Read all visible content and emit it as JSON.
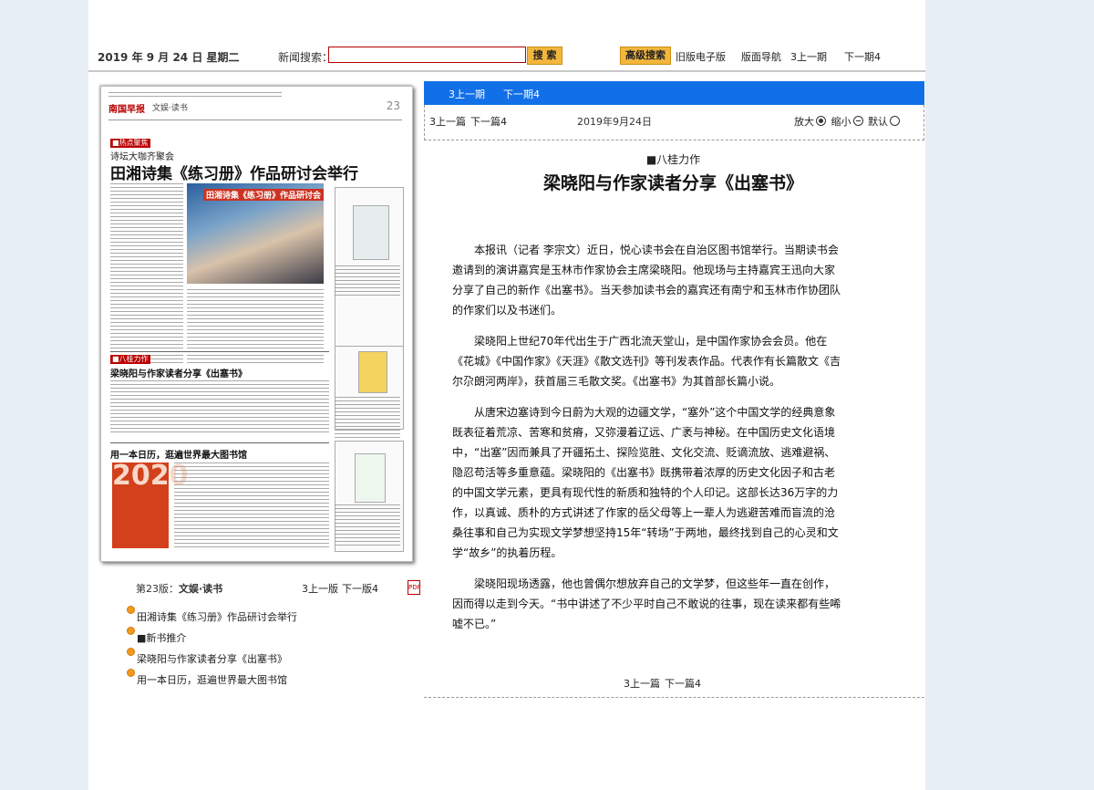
{
  "topbar": {
    "date": "2019 年 9 月 24 日   星期二",
    "search_label": "新闻搜索：",
    "search_value": "",
    "search_button": "搜 索",
    "advanced_search": "高级搜索",
    "old_edition": "旧版电子版",
    "nav": "版面导航",
    "prev_issue": "3上一期",
    "next_issue": "下一期4"
  },
  "thumbnail": {
    "logo": "南国早报",
    "section": "文娱·读书",
    "page_number": "23",
    "tag1": "■热点聚焦",
    "sub1": "诗坛大咖齐聚会",
    "title1": "田湘诗集《练习册》作品研讨会举行",
    "photo_caption": "田湘诗集《练习册》作品研讨会",
    "tag2": "■八桂力作",
    "title2": "梁晓阳与作家读者分享《出塞书》",
    "title3": "用一本日历，逛遍世界最大图书馆",
    "cover_text": "2020"
  },
  "page_info": {
    "label": "第23版：",
    "name": "文娱·读书",
    "prev": "3上一版",
    "next": "下一版4",
    "pdf": "PDF"
  },
  "toc": [
    "田湘诗集《练习册》作品研讨会举行",
    "■新书推介",
    "梁晓阳与作家读者分享《出塞书》",
    "用一本日历，逛遍世界最大图书馆"
  ],
  "article_nav": {
    "bar_prev": "3上一期",
    "bar_next": "下一期4",
    "prev": "3上一篇",
    "next": "下一篇4",
    "date": "2019年9月24日",
    "zoom_in": "放大",
    "zoom_out": "缩小",
    "default": "默认"
  },
  "article": {
    "kicker": "■八桂力作",
    "title": "梁晓阳与作家读者分享《出塞书》",
    "paragraphs": [
      "本报讯（记者 李宗文）近日，悦心读书会在自治区图书馆举行。当期读书会邀请到的演讲嘉宾是玉林市作家协会主席梁晓阳。他现场与主持嘉宾王迅向大家分享了自己的新作《出塞书》。当天参加读书会的嘉宾还有南宁和玉林市作协团队的作家们以及书迷们。",
      "梁晓阳上世纪70年代出生于广西北流天堂山，是中国作家协会会员。他在《花城》《中国作家》《天涯》《散文选刊》等刊发表作品。代表作有长篇散文《吉尔尕朗河两岸》，获首届三毛散文奖。《出塞书》为其首部长篇小说。",
      "从唐宋边塞诗到今日蔚为大观的边疆文学，“塞外”这个中国文学的经典意象既表征着荒凉、苦寒和贫瘠，又弥漫着辽远、广袤与神秘。在中国历史文化语境中，“出塞”因而兼具了开疆拓土、探险览胜、文化交流、贬谪流放、逃难避祸、隐忍苟活等多重意蕴。梁晓阳的《出塞书》既携带着浓厚的历史文化因子和古老的中国文学元素，更具有现代性的新质和独特的个人印记。这部长达36万字的力作，以真诚、质朴的方式讲述了作家的岳父母等上一辈人为逃避苦难而盲流的沧桑往事和自己为实现文学梦想坚持15年“转场”于两地，最终找到自己的心灵和文学“故乡”的执着历程。",
      "梁晓阳现场透露，他也曾偶尔想放弃自己的文学梦，但这些年一直在创作，因而得以走到今天。“书中讲述了不少平时自己不敢说的往事，现在读来都有些唏嘘不已。”"
    ],
    "bottom_prev": "3上一篇",
    "bottom_next": "下一篇4"
  }
}
